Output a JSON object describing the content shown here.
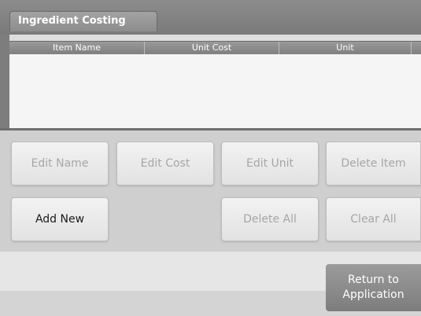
{
  "header": {
    "title": "Ingredient Costing"
  },
  "table": {
    "columns": [
      "Item Name",
      "Unit Cost",
      "Unit"
    ],
    "rows": []
  },
  "buttons": {
    "edit_name": "Edit Name",
    "edit_cost": "Edit Cost",
    "edit_unit": "Edit Unit",
    "delete_item": "Delete Item",
    "add_new": "Add New",
    "delete_all": "Delete All",
    "clear_all": "Clear All"
  },
  "footer": {
    "return_line1": "Return to",
    "return_line2": "Application"
  }
}
